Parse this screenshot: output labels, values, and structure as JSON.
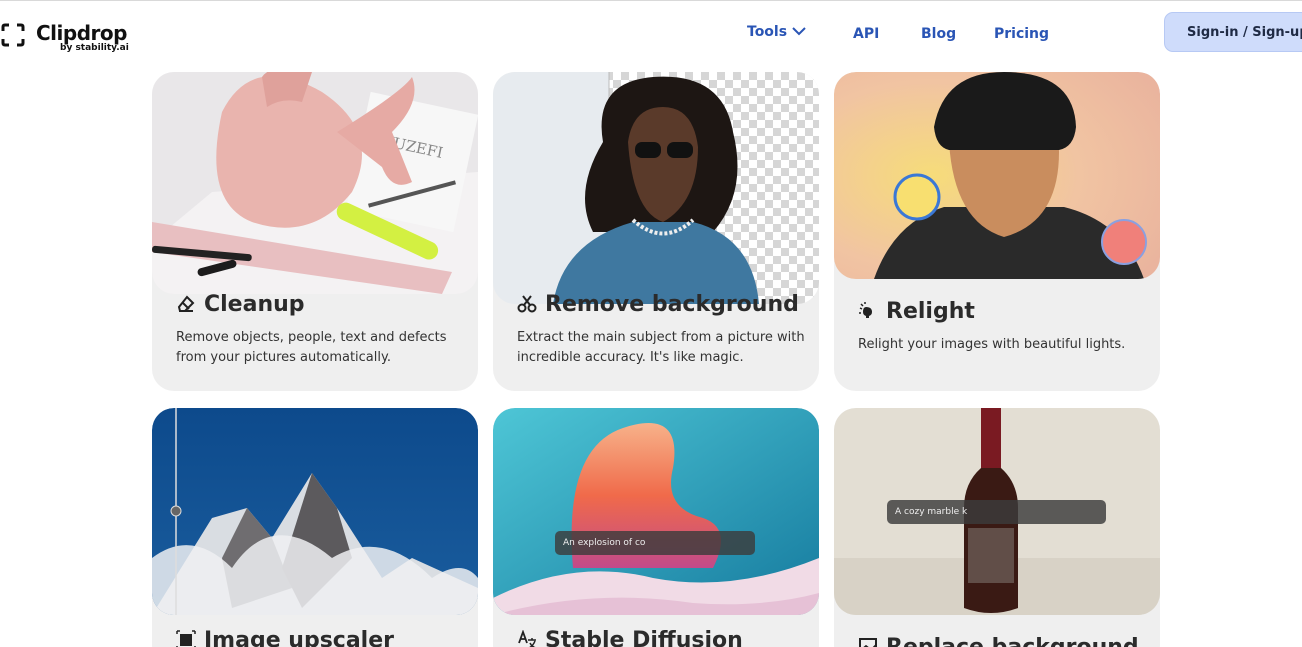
{
  "header": {
    "logo_text": "Clipdrop",
    "logo_sub": "by stability.ai",
    "nav": {
      "tools": "Tools",
      "api": "API",
      "blog": "Blog",
      "pricing": "Pricing"
    },
    "signin_label": "Sign-in / Sign-up"
  },
  "cards": [
    {
      "title": "Cleanup",
      "desc": "Remove objects, people, text and defects from your pictures automatically.",
      "icon": "eraser-icon"
    },
    {
      "title": "Remove background",
      "desc": "Extract the main subject from a picture with incredible accuracy. It's like magic.",
      "icon": "scissors-icon"
    },
    {
      "title": "Relight",
      "desc": "Relight your images with beautiful lights.",
      "icon": "lightbulb-icon"
    },
    {
      "title": "Image upscaler",
      "icon": "upscale-icon"
    },
    {
      "title": "Stable Diffusion",
      "icon": "translate-icon",
      "prompt": "An explosion of co"
    },
    {
      "title": "Replace background",
      "icon": "replace-icon",
      "prompt": "A cozy marble k"
    }
  ],
  "colors": {
    "nav_link": "#2a55b5",
    "signin_bg": "#cfdcfb",
    "card_bg": "#efefef"
  }
}
